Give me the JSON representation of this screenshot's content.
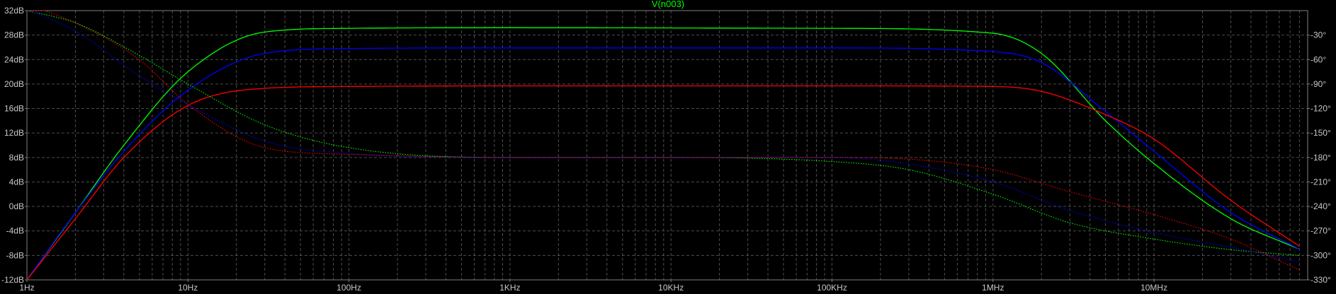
{
  "chart_data": {
    "type": "line",
    "title": "V(n003)",
    "title_color": "#00ff00",
    "background": "#000000",
    "axis_color": "#808080",
    "grid": true,
    "grid_color": "#8c8c8c",
    "x_scale": "log",
    "xlim": [
      1,
      90000000
    ],
    "x_ticks": [
      {
        "value": 1,
        "label": "1Hz"
      },
      {
        "value": 10,
        "label": "10Hz"
      },
      {
        "value": 100,
        "label": "100Hz"
      },
      {
        "value": 1000,
        "label": "1KHz"
      },
      {
        "value": 10000,
        "label": "10KHz"
      },
      {
        "value": 100000,
        "label": "100KHz"
      },
      {
        "value": 1000000,
        "label": "1MHz"
      },
      {
        "value": 10000000,
        "label": "10MHz"
      }
    ],
    "y_left": {
      "ylim": [
        -12,
        32
      ],
      "ticks": [
        {
          "value": 32,
          "label": "32dB"
        },
        {
          "value": 28,
          "label": "28dB"
        },
        {
          "value": 24,
          "label": "24dB"
        },
        {
          "value": 20,
          "label": "20dB"
        },
        {
          "value": 16,
          "label": "16dB"
        },
        {
          "value": 12,
          "label": "12dB"
        },
        {
          "value": 8,
          "label": "8dB"
        },
        {
          "value": 4,
          "label": "4dB"
        },
        {
          "value": 0,
          "label": "0dB"
        },
        {
          "value": -4,
          "label": "-4dB"
        },
        {
          "value": -8,
          "label": "-8dB"
        },
        {
          "value": -12,
          "label": "-12dB"
        }
      ]
    },
    "y_right": {
      "ylim": [
        -330,
        0
      ],
      "ticks": [
        {
          "value": -30,
          "label": "-30°"
        },
        {
          "value": -60,
          "label": "-60°"
        },
        {
          "value": -90,
          "label": "-90°"
        },
        {
          "value": -120,
          "label": "-120°"
        },
        {
          "value": -150,
          "label": "-150°"
        },
        {
          "value": -180,
          "label": "-180°"
        },
        {
          "value": -210,
          "label": "-210°"
        },
        {
          "value": -240,
          "label": "-240°"
        },
        {
          "value": -270,
          "label": "-270°"
        },
        {
          "value": -300,
          "label": "-300°"
        },
        {
          "value": -330,
          "label": "-330°"
        }
      ]
    },
    "series": [
      {
        "color": "#00ff00",
        "style": "solid",
        "axis": "left",
        "points": [
          [
            1,
            -12
          ],
          [
            2,
            -1
          ],
          [
            4,
            10
          ],
          [
            10,
            22
          ],
          [
            30,
            28.5
          ],
          [
            100,
            29.1
          ],
          [
            1000,
            29.2
          ],
          [
            100000,
            29.1
          ],
          [
            1000000,
            28.3
          ],
          [
            2000000,
            25
          ],
          [
            5000000,
            14
          ],
          [
            10000000,
            7
          ],
          [
            30000000,
            -2
          ],
          [
            80000000,
            -7
          ]
        ]
      },
      {
        "color": "#0000ff",
        "style": "solid",
        "axis": "left",
        "points": [
          [
            1,
            -12
          ],
          [
            2,
            -1
          ],
          [
            4,
            9
          ],
          [
            10,
            19
          ],
          [
            30,
            25
          ],
          [
            100,
            25.8
          ],
          [
            1000,
            25.9
          ],
          [
            100000,
            25.9
          ],
          [
            1000000,
            25.3
          ],
          [
            2000000,
            23.5
          ],
          [
            5000000,
            15.5
          ],
          [
            10000000,
            9
          ],
          [
            30000000,
            -1
          ],
          [
            80000000,
            -7
          ]
        ]
      },
      {
        "color": "#ff0000",
        "style": "solid",
        "axis": "left",
        "points": [
          [
            1,
            -12
          ],
          [
            2,
            -2
          ],
          [
            4,
            8
          ],
          [
            10,
            16.5
          ],
          [
            30,
            19.3
          ],
          [
            100,
            19.6
          ],
          [
            1000,
            19.7
          ],
          [
            100000,
            19.7
          ],
          [
            1000000,
            19.6
          ],
          [
            2000000,
            18.8
          ],
          [
            5000000,
            15
          ],
          [
            10000000,
            11
          ],
          [
            30000000,
            1
          ],
          [
            80000000,
            -6.5
          ]
        ]
      },
      {
        "color": "#00ff00",
        "style": "dotted",
        "axis": "right",
        "points": [
          [
            1,
            0
          ],
          [
            2,
            -15
          ],
          [
            5,
            -55
          ],
          [
            10,
            -90
          ],
          [
            30,
            -140
          ],
          [
            100,
            -168
          ],
          [
            1000,
            -180
          ],
          [
            10000,
            -180
          ],
          [
            100000,
            -185
          ],
          [
            300000,
            -195
          ],
          [
            1000000,
            -225
          ],
          [
            3000000,
            -260
          ],
          [
            10000000,
            -280
          ],
          [
            30000000,
            -293
          ],
          [
            80000000,
            -300
          ]
        ]
      },
      {
        "color": "#0000ff",
        "style": "dotted",
        "axis": "right",
        "points": [
          [
            1,
            2
          ],
          [
            2,
            -25
          ],
          [
            5,
            -80
          ],
          [
            10,
            -115
          ],
          [
            30,
            -160
          ],
          [
            100,
            -175
          ],
          [
            1000,
            -180
          ],
          [
            10000,
            -180
          ],
          [
            100000,
            -180
          ],
          [
            300000,
            -188
          ],
          [
            1000000,
            -210
          ],
          [
            3000000,
            -245
          ],
          [
            10000000,
            -272
          ],
          [
            30000000,
            -290
          ],
          [
            80000000,
            -308
          ]
        ]
      },
      {
        "color": "#ff0000",
        "style": "dotted",
        "axis": "right",
        "points": [
          [
            1,
            8
          ],
          [
            2,
            -15
          ],
          [
            5,
            -60
          ],
          [
            10,
            -115
          ],
          [
            30,
            -168
          ],
          [
            100,
            -176
          ],
          [
            1000,
            -180
          ],
          [
            10000,
            -180
          ],
          [
            100000,
            -180
          ],
          [
            300000,
            -182
          ],
          [
            1000000,
            -195
          ],
          [
            3000000,
            -222
          ],
          [
            10000000,
            -250
          ],
          [
            30000000,
            -280
          ],
          [
            80000000,
            -318
          ]
        ]
      }
    ]
  }
}
